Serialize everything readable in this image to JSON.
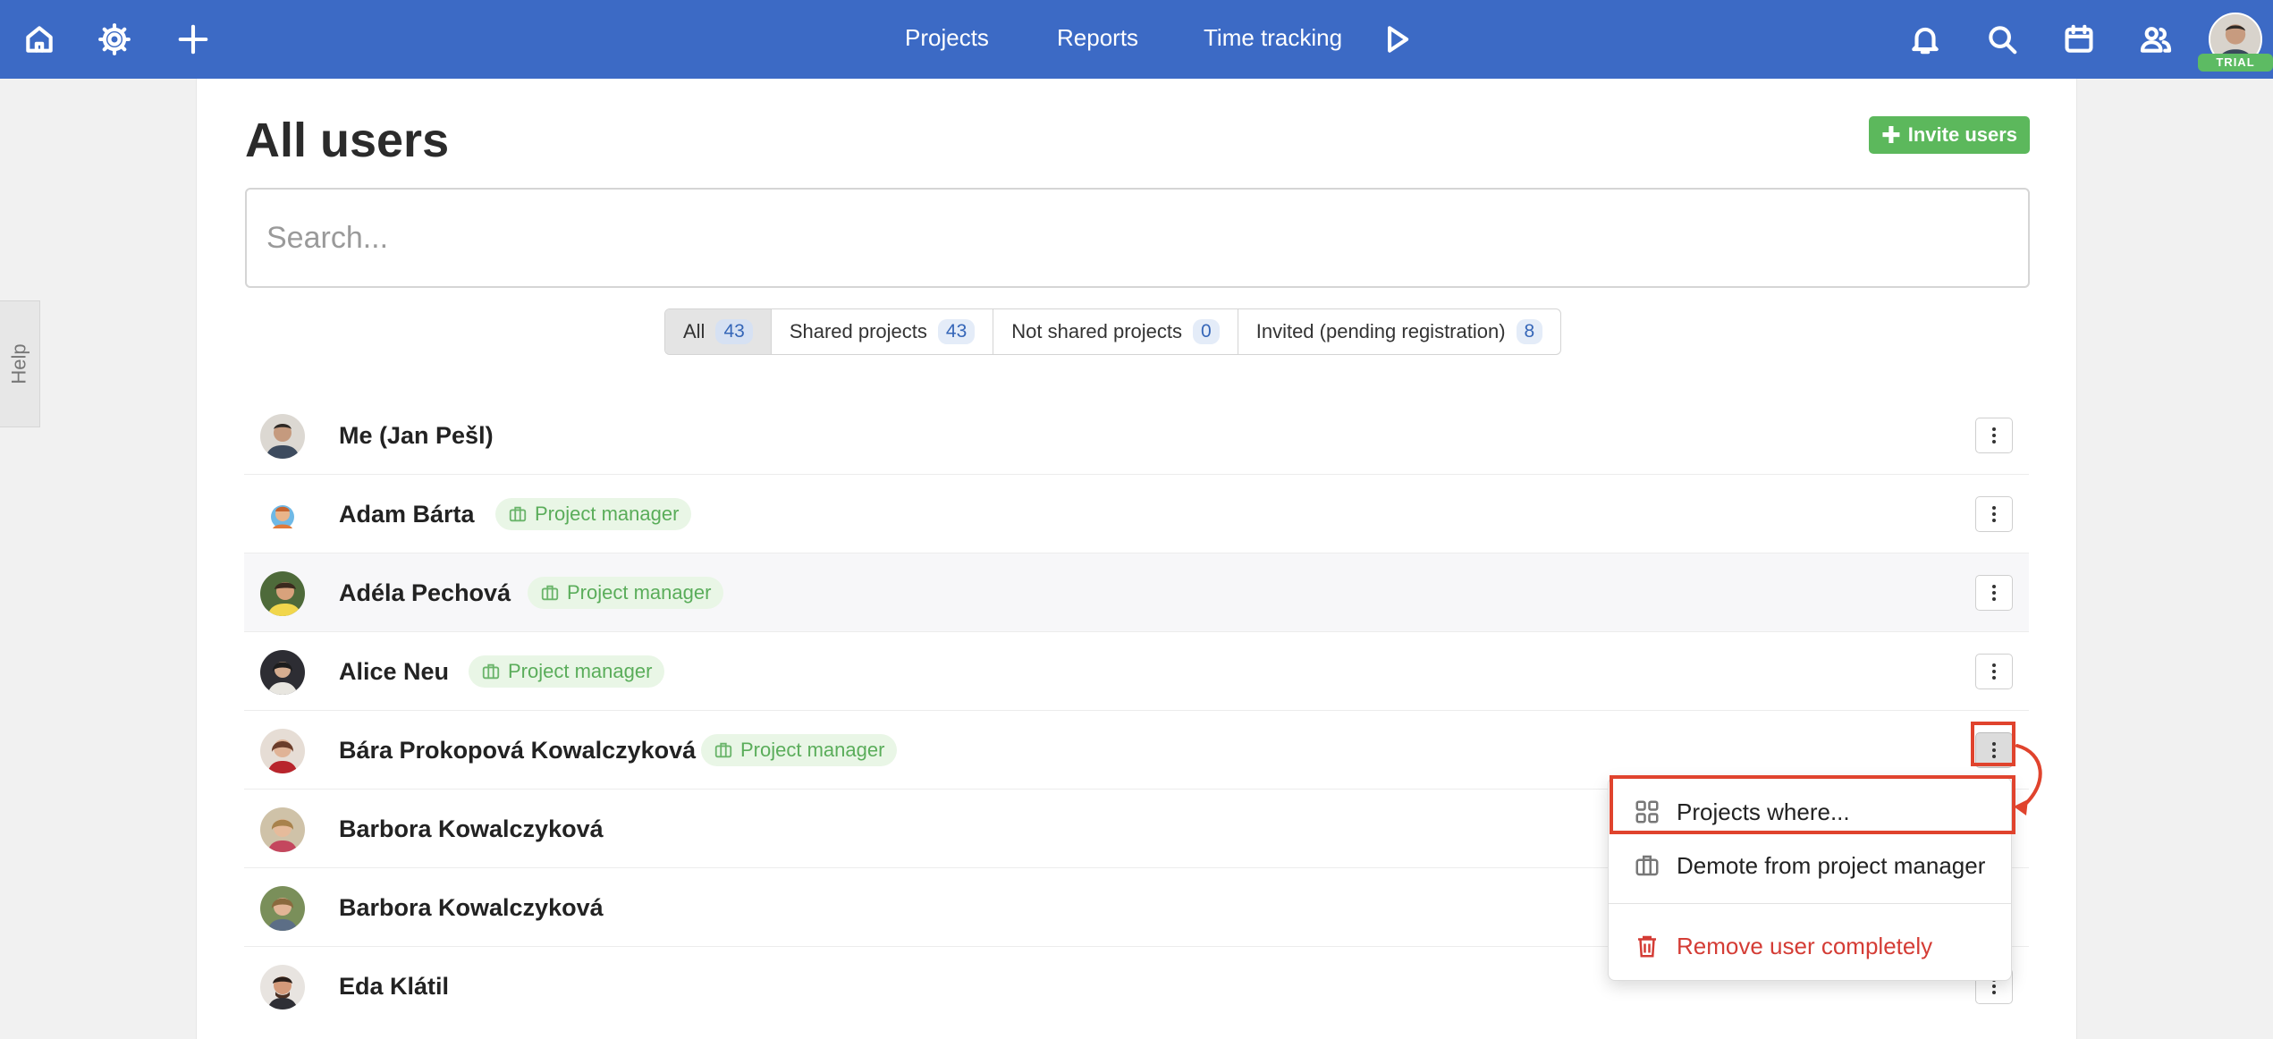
{
  "topbar": {
    "nav": [
      "Projects",
      "Reports",
      "Time tracking"
    ],
    "trial_badge": "TRIAL",
    "icons": [
      "home-icon",
      "gear-icon",
      "plus-icon",
      "play-icon",
      "bell-icon",
      "search-icon",
      "calendar-icon",
      "users-icon"
    ]
  },
  "help_tab": "Help",
  "page": {
    "title": "All users",
    "invite_label": "Invite users",
    "search_placeholder": "Search..."
  },
  "filters": [
    {
      "label": "All",
      "count": "43"
    },
    {
      "label": "Shared projects",
      "count": "43"
    },
    {
      "label": "Not shared projects",
      "count": "0"
    },
    {
      "label": "Invited (pending registration)",
      "count": "8"
    }
  ],
  "users": [
    {
      "name": "Me (Jan Pešl)",
      "role": ""
    },
    {
      "name": "Adam Bárta",
      "role": "Project manager"
    },
    {
      "name": "Adéla Pechová",
      "role": "Project manager"
    },
    {
      "name": "Alice Neu",
      "role": "Project manager"
    },
    {
      "name": "Bára Prokopová Kowalczyková",
      "role": "Project manager"
    },
    {
      "name": "Barbora Kowalczyková",
      "role": ""
    },
    {
      "name": "Barbora Kowalczyková",
      "role": ""
    },
    {
      "name": "Eda Klátil",
      "role": ""
    }
  ],
  "dropdown": {
    "items": [
      "Projects where...",
      "Demote from project manager",
      "Remove user completely"
    ]
  },
  "colors": {
    "topbar": "#3c6ac5",
    "invite": "#5cb85c",
    "role_badge_text": "#5aad5a",
    "danger": "#d43c35",
    "annotation": "#e0432d"
  }
}
